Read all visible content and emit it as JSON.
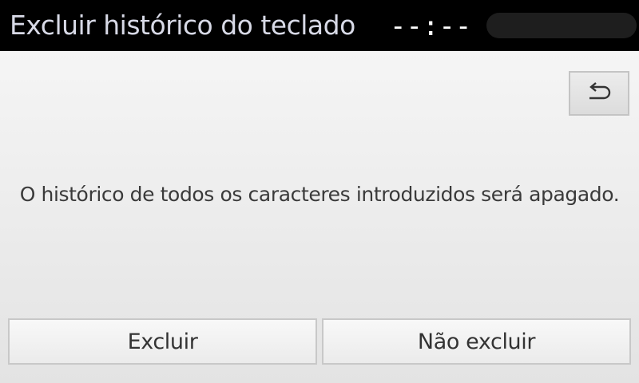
{
  "header": {
    "title": "Excluir histórico do teclado",
    "clock": "--:--"
  },
  "toolbar": {
    "back_icon": "undo-arrow-icon"
  },
  "message": {
    "text": "O histórico de todos os caracteres introduzidos será apagado."
  },
  "actions": {
    "confirm_label": "Excluir",
    "cancel_label": "Não excluir"
  },
  "colors": {
    "header_bg": "#000000",
    "title_text": "#d7d9e6",
    "body_text": "#3a3a3a"
  }
}
